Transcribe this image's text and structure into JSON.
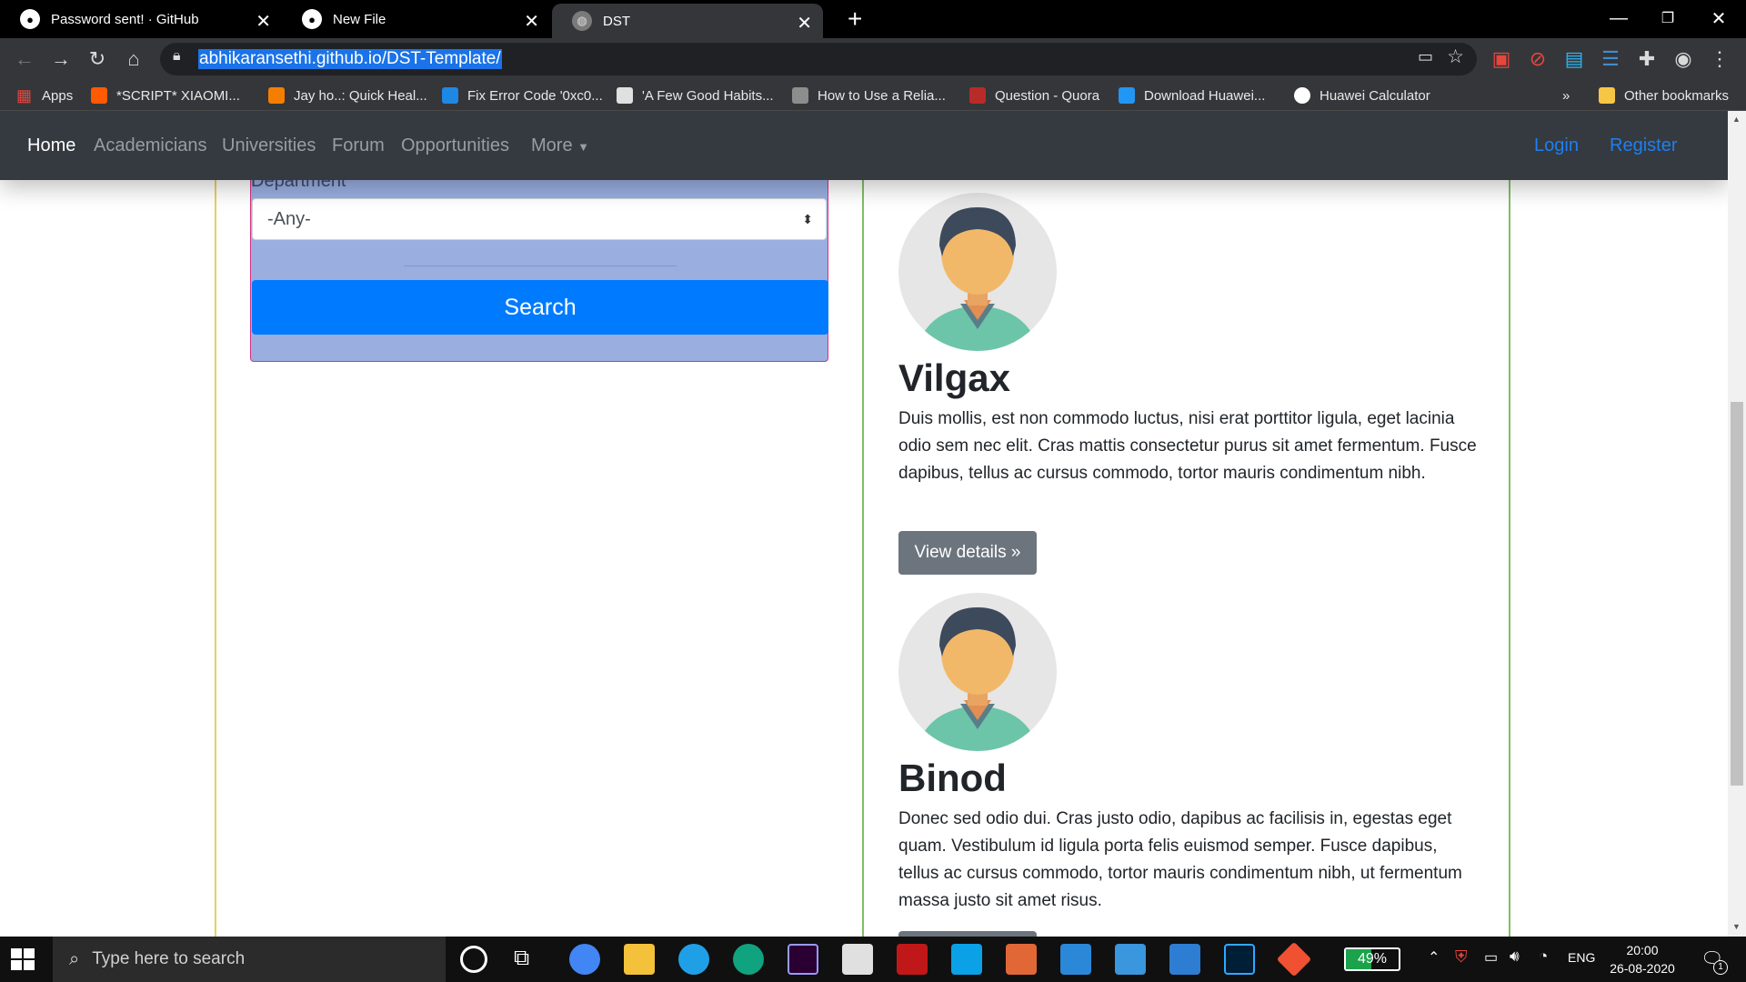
{
  "browser": {
    "tabs": [
      {
        "title": "Password sent! · GitHub",
        "icon": "github-icon"
      },
      {
        "title": "New File",
        "icon": "github-icon"
      },
      {
        "title": "DST",
        "icon": "globe-icon",
        "active": true
      }
    ],
    "new_tab_label": "+",
    "url": "abhikaransethi.github.io/DST-Template/",
    "bookmarks": [
      {
        "label": "Apps",
        "color": "#e8453c"
      },
      {
        "label": "*SCRIPT* XIAOMI...",
        "color": "#ff5a00"
      },
      {
        "label": "Jay ho..: Quick Heal...",
        "color": "#f57d00"
      },
      {
        "label": "Fix Error Code '0xc0...",
        "color": "#1e88e5"
      },
      {
        "label": "'A Few Good Habits...",
        "color": "#e0e0e0"
      },
      {
        "label": "How to Use a Relia...",
        "color": "#8d8d8d"
      },
      {
        "label": "Question - Quora",
        "color": "#b92b27"
      },
      {
        "label": "Download Huawei...",
        "color": "#2196f3"
      },
      {
        "label": "Huawei Calculator",
        "color": "#ffffff"
      }
    ],
    "bookmarks_overflow": "»",
    "other_bookmarks": "Other bookmarks"
  },
  "navbar": {
    "links": [
      "Home",
      "Academicians",
      "Universities",
      "Forum",
      "Opportunities",
      "More"
    ],
    "login": "Login",
    "register": "Register"
  },
  "search_form": {
    "department_label": "Department",
    "department_value": "-Any-",
    "search_button": "Search"
  },
  "people": [
    {
      "name": "Vilgax",
      "bio": "Duis mollis, est non commodo luctus, nisi erat porttitor ligula, eget lacinia odio sem nec elit. Cras mattis consectetur purus sit amet fermentum. Fusce dapibus, tellus ac cursus commodo, tortor mauris condimentum nibh.",
      "button": "View details »"
    },
    {
      "name": "Binod",
      "bio": "Donec sed odio dui. Cras justo odio, dapibus ac facilisis in, egestas eget quam. Vestibulum id ligula porta felis euismod semper. Fusce dapibus, tellus ac cursus commodo, tortor mauris condimentum nibh, ut fermentum massa justo sit amet risus."
    }
  ],
  "taskbar": {
    "search_placeholder": "Type here to search",
    "battery": "49%",
    "language": "ENG",
    "time": "20:00",
    "date": "26-08-2020",
    "notification_count": "1",
    "apps": [
      {
        "name": "chrome-icon",
        "color": "#4285f4"
      },
      {
        "name": "file-explorer-icon",
        "color": "#f3c13a"
      },
      {
        "name": "edge-icon",
        "color": "#1fa0e6"
      },
      {
        "name": "chatgpt-like-icon",
        "color": "#10a37f"
      },
      {
        "name": "premiere-icon",
        "color": "#9999ff"
      },
      {
        "name": "store-icon",
        "color": "#e0e0e0"
      },
      {
        "name": "mcafee-icon",
        "color": "#c01818"
      },
      {
        "name": "l-app-icon",
        "color": "#0aa1e6"
      },
      {
        "name": "matlab-icon",
        "color": "#e16737"
      },
      {
        "name": "mail-icon",
        "color": "#2b88d8"
      },
      {
        "name": "phone-icon",
        "color": "#3a96dd"
      },
      {
        "name": "photos-icon",
        "color": "#2d7dd2"
      },
      {
        "name": "photoshop-icon",
        "color": "#31a8ff"
      },
      {
        "name": "git-icon",
        "color": "#f05133"
      }
    ]
  }
}
